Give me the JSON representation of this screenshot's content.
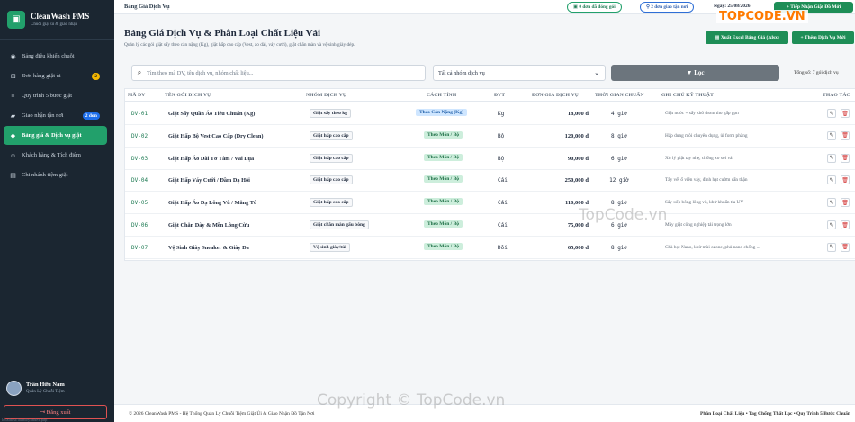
{
  "brand": {
    "name": "CleanWash PMS",
    "subtitle": "Chuỗi giặt ủi & giao nhận"
  },
  "sidebar": {
    "items": [
      {
        "label": "Bảng điều khiển chuỗi",
        "icon": "dashboard-icon"
      },
      {
        "label": "Đơn hàng giặt ủi",
        "icon": "cart-icon",
        "badge": "2"
      },
      {
        "label": "Quy trình 5 bước giặt",
        "icon": "list-icon"
      },
      {
        "label": "Giao nhận tận nơi",
        "icon": "truck-icon",
        "badge": "2 đơn"
      },
      {
        "label": "Bảng giá & Dịch vụ giặt",
        "icon": "tag-icon",
        "active": true
      },
      {
        "label": "Khách hàng & Tích điểm",
        "icon": "users-icon"
      },
      {
        "label": "Chi nhánh tiệm giặt",
        "icon": "store-icon"
      }
    ],
    "user": {
      "name": "Trần Hữu Nam",
      "role": "Quản Lý Chuỗi Tiệm"
    },
    "logout": "Đăng xuất",
    "url_hint": "localhost/laundry/index.php"
  },
  "topbar": {
    "breadcrumb": "Bảng Giá Dịch Vụ",
    "pill_orders": "0 đơn đã đóng gói",
    "pill_delivery": "2 đơn giao tận nơi",
    "date": "Ngày: 25/08/2026",
    "new_order": "+ Tiếp Nhận Giặt Đồ Mới"
  },
  "page": {
    "title": "Bảng Giá Dịch Vụ & Phân Loại Chất Liệu Vải",
    "subtitle": "Quản lý các gói giặt sấy theo cân nặng (Kg), giặt hấp cao cấp (Vest, áo dài, váy cưới), giặt chăn màn và vệ sinh giày dép.",
    "export_button": "Xuất Excel Bảng Giá (.xlsx)",
    "add_button": "+ Thêm Dịch Vụ Mới"
  },
  "filters": {
    "search_placeholder": "Tìm theo mã DV, tên dịch vụ, nhóm chất liệu...",
    "group_select": "Tất cả nhóm dịch vụ",
    "filter_button": "Lọc",
    "total": "Tổng số: 7 gói dịch vụ"
  },
  "table": {
    "headers": [
      "MÃ DV",
      "TÊN GÓI DỊCH VỤ",
      "NHÓM DỊCH VỤ",
      "CÁCH TÍNH",
      "ĐVT",
      "ĐƠN GIÁ DỊCH VỤ",
      "THỜI GIAN CHUẨN",
      "GHI CHÚ KỸ THUẬT",
      "THAO TÁC"
    ],
    "rows": [
      {
        "code": "DV-01",
        "name": "Giặt Sấy Quần Áo Tiêu Chuẩn (Kg)",
        "group": "Giặt sấy theo kg",
        "calc": "Theo Cân Nặng (Kg)",
        "calc_type": "kg",
        "unit": "Kg",
        "price": "18,000 đ",
        "time": "4 giờ",
        "note": "Giặt nước + sấy khô thơm tho gấp gọn"
      },
      {
        "code": "DV-02",
        "name": "Giặt Hấp Bộ Vest Cao Cấp (Dry Clean)",
        "group": "Giặt hấp cao cấp",
        "calc": "Theo Món / Bộ",
        "calc_type": "set",
        "unit": "Bộ",
        "price": "120,000 đ",
        "time": "8 giờ",
        "note": "Hấp dung môi chuyên dụng, ủi form phẳng"
      },
      {
        "code": "DV-03",
        "name": "Giặt Hấp Áo Dài Tơ Tằm / Vải Lụa",
        "group": "Giặt hấp cao cấp",
        "calc": "Theo Món / Bộ",
        "calc_type": "set",
        "unit": "Bộ",
        "price": "90,000 đ",
        "time": "6 giờ",
        "note": "Xử lý giặt tay nhẹ, chống xơ sơi vải"
      },
      {
        "code": "DV-04",
        "name": "Giặt Hấp Váy Cưới / Đầm Dạ Hội",
        "group": "Giặt hấp cao cấp",
        "calc": "Theo Món / Bộ",
        "calc_type": "set",
        "unit": "Cái",
        "price": "250,000 đ",
        "time": "12 giờ",
        "note": "Tẩy vết ố viền váy, đính hạt cườm cẩn thận"
      },
      {
        "code": "DV-05",
        "name": "Giặt Hấp Áo Dạ Lông Vũ / Măng Tô",
        "group": "Giặt hấp cao cấp",
        "calc": "Theo Món / Bộ",
        "calc_type": "set",
        "unit": "Cái",
        "price": "110,000 đ",
        "time": "8 giờ",
        "note": "Sấy xốp bông lông vũ, khử khuẩn tia UV"
      },
      {
        "code": "DV-06",
        "name": "Giặt Chăn Dày & Mền Lông Cừu",
        "group": "Giặt chăn màn gấu bông",
        "calc": "Theo Món / Bộ",
        "calc_type": "set",
        "unit": "Cái",
        "price": "75,000 đ",
        "time": "6 giờ",
        "note": "Máy giặt công nghiệp tải trọng lớn"
      },
      {
        "code": "DV-07",
        "name": "Vệ Sinh Giày Sneaker & Giày Da",
        "group": "Vệ sinh giày/túi",
        "calc": "Theo Món / Bộ",
        "calc_type": "set",
        "unit": "Đôi",
        "price": "65,000 đ",
        "time": "8 giờ",
        "note": "Chà bọt Nano, khử mùi ozone, phủ nano chống ..."
      }
    ]
  },
  "footer": {
    "left": "© 2026 CleanWash PMS - Hệ Thống Quản Lý Chuỗi Tiệm Giặt Ủi & Giao Nhận Đồ Tận Nơi",
    "right": "Phân Loại Chất Liệu • Tag Chống Thất Lạc • Quy Trình 5 Bước Chuẩn"
  },
  "watermarks": {
    "logo": "TOPCODE.VN",
    "center": "TopCode.vn",
    "bottom": "Copyright © TopCode.vn"
  },
  "colors": {
    "accent": "#22a06b",
    "sidebar_bg": "#1b2631",
    "danger": "#d12f2f"
  }
}
